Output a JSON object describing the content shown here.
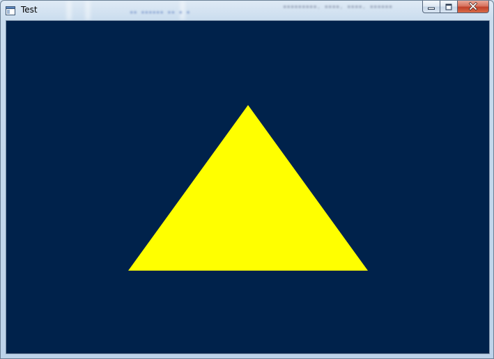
{
  "window": {
    "title": "Test",
    "icon": "application-window-icon",
    "buttons": {
      "minimize": "minimize-icon",
      "maximize": "maximize-icon",
      "close": "close-icon"
    }
  },
  "scene": {
    "background_color": "#00224b",
    "shape": "triangle",
    "shape_color": "#ffff00"
  }
}
